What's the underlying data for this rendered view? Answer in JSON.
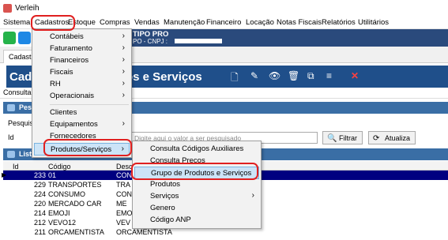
{
  "window": {
    "title": "Verleih"
  },
  "menubar": [
    "Sistema",
    "Cadastros",
    "Estoque",
    "Compras",
    "Vendas",
    "Manutenção",
    "Financeiro",
    "Locação",
    "Notas Fiscais",
    "Relatórios",
    "Utilitários"
  ],
  "company": {
    "name": "TIPO PRO",
    "cnpj_label": "PO - CNPJ :"
  },
  "tab": "Cadastro",
  "header": {
    "title_left": "Cada",
    "title_right": "tos e Serviços"
  },
  "subtab": "Consultar",
  "panel": {
    "title": "Pesqu"
  },
  "search": {
    "label": "Pesquisa",
    "placeholder": "Digite aqui o valor a ser pesquisado",
    "filter_button": "Filtrar",
    "update_button": "Atualiza"
  },
  "id_label": "Id",
  "list_panel": {
    "title": "Lista"
  },
  "table": {
    "headers": [
      "Id",
      "Código",
      "Desc"
    ],
    "rows": [
      {
        "id": "233",
        "code": "01",
        "desc": "CON"
      },
      {
        "id": "229",
        "code": "TRANSPORTES",
        "desc": "TRA"
      },
      {
        "id": "224",
        "code": "CONSUMO",
        "desc": "CON"
      },
      {
        "id": "220",
        "code": "MERCADO CAR",
        "desc": "ME"
      },
      {
        "id": "214",
        "code": "EMOJI",
        "desc": "EMO"
      },
      {
        "id": "212",
        "code": "VEVO12",
        "desc": "VEV"
      },
      {
        "id": "211",
        "code": "ORCAMENTISTA",
        "desc": "ORCAMENTISTA"
      }
    ]
  },
  "menu_cadastros": {
    "items": [
      {
        "label": "Contábeis",
        "submenu": true
      },
      {
        "label": "Faturamento",
        "submenu": true
      },
      {
        "label": "Financeiros",
        "submenu": true
      },
      {
        "label": "Fiscais",
        "submenu": true
      },
      {
        "label": "RH",
        "submenu": true
      },
      {
        "label": "Operacionais",
        "submenu": true
      },
      {
        "label": "Clientes",
        "submenu": false
      },
      {
        "label": "Equipamentos",
        "submenu": true
      },
      {
        "label": "Fornecedores",
        "submenu": false
      },
      {
        "label": "Produtos/Serviços",
        "submenu": true
      }
    ]
  },
  "menu_produtos": {
    "items": [
      {
        "label": "Consulta Códigos Auxiliares",
        "submenu": false
      },
      {
        "label": "Consulta Preços",
        "submenu": false
      },
      {
        "label": "Grupo de Produtos e Serviços",
        "submenu": false
      },
      {
        "label": "Produtos",
        "submenu": false
      },
      {
        "label": "Serviços",
        "submenu": true
      },
      {
        "label": "Genero",
        "submenu": false
      },
      {
        "label": "Código ANP",
        "submenu": false
      }
    ]
  },
  "colors": {
    "header_blue": "#1f4f8a",
    "panel_blue": "#3a6ea5",
    "highlight_red": "#e02020",
    "selection": "#000080"
  },
  "arrow_glyph": "›"
}
